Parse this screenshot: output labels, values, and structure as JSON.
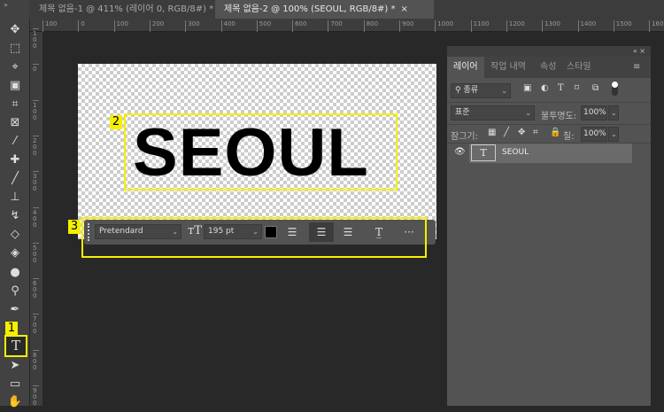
{
  "tabs": [
    {
      "label": "제목 없음-1 @ 411% (레이어 0, RGB/8#) *",
      "active": false
    },
    {
      "label": "제목 없음-2 @ 100% (SEOUL, RGB/8#) *",
      "active": true
    }
  ],
  "collapse_label": "»",
  "ruler_h": [
    "100",
    "0",
    "100",
    "200",
    "300",
    "400",
    "500",
    "600",
    "700",
    "800",
    "900",
    "1000",
    "1100",
    "1200",
    "1300",
    "1400",
    "1500",
    "1600"
  ],
  "ruler_v": [
    "100",
    "0",
    "100",
    "200",
    "300",
    "400",
    "500",
    "600",
    "700",
    "800",
    "900"
  ],
  "canvas_text": "SEOUL",
  "annotations": {
    "tool": "1",
    "text_box": "2",
    "options_bar": "3"
  },
  "options": {
    "font": "Pretendard",
    "size": "195 pt",
    "color": "#000000",
    "more": "···"
  },
  "panel": {
    "controls": "« ×",
    "tabs": [
      "레이어",
      "작업 내역",
      "속성",
      "스타일"
    ],
    "filter": "종류",
    "blend": "표준",
    "opacity_label": "불투명도:",
    "opacity": "100%",
    "lock_label": "잠그기:",
    "fill_label": "칠:",
    "fill": "100%",
    "layer": {
      "name": "SEOUL",
      "thumb": "T"
    }
  },
  "accent": "#f5ef00"
}
